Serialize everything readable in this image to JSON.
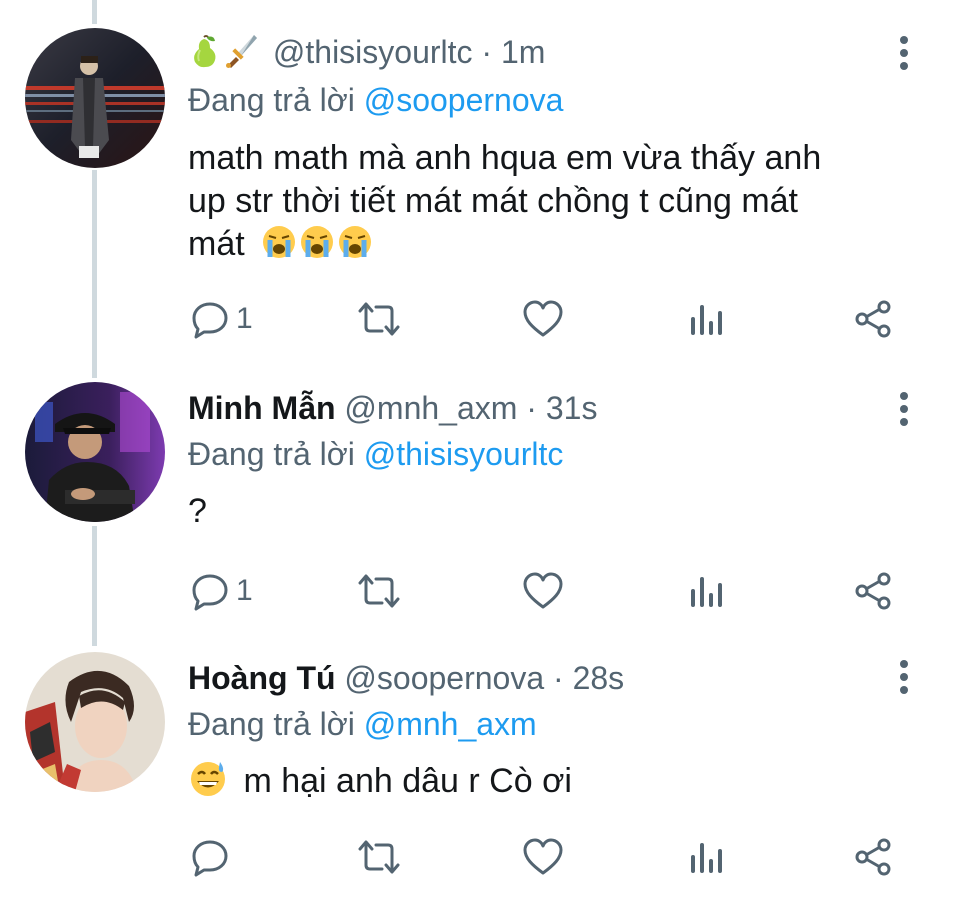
{
  "thread": [
    {
      "display_name": "",
      "name_emojis": [
        "pear-emoji",
        "dagger-emoji"
      ],
      "handle": "@thisisyourltc",
      "separator": "·",
      "time": "1m",
      "reply_prefix": "Đang trả lời",
      "reply_to": "@soopernova",
      "body_lines": [
        "math math mà anh hqua em vừa thấy anh",
        "up str thời tiết mát mát chồng t cũng mát",
        "mát"
      ],
      "body_emojis": [
        "loudly-crying-face-emoji",
        "loudly-crying-face-emoji",
        "loudly-crying-face-emoji"
      ],
      "reply_count": "1"
    },
    {
      "display_name": "Minh Mẫn",
      "handle": "@mnh_axm",
      "separator": "·",
      "time": "31s",
      "reply_prefix": "Đang trả lời",
      "reply_to": "@thisisyourltc",
      "body": "?",
      "reply_count": "1"
    },
    {
      "display_name": "Hoàng Tú",
      "handle": "@soopernova",
      "separator": "·",
      "time": "28s",
      "reply_prefix": "Đang trả lời",
      "reply_to": "@mnh_axm",
      "body_emoji": "grinning-sweat-face-emoji",
      "body": "m hại anh dâu r Cò ơi",
      "reply_count": ""
    }
  ],
  "icons": {
    "reply": "reply-icon",
    "retweet": "retweet-icon",
    "like": "heart-icon",
    "analytics": "analytics-icon",
    "share": "share-icon",
    "more": "more-vertical-icon"
  },
  "colors": {
    "text": "#14171a",
    "secondary": "#536471",
    "mention": "#1d9bf0",
    "thread_line": "#cfd9de"
  }
}
